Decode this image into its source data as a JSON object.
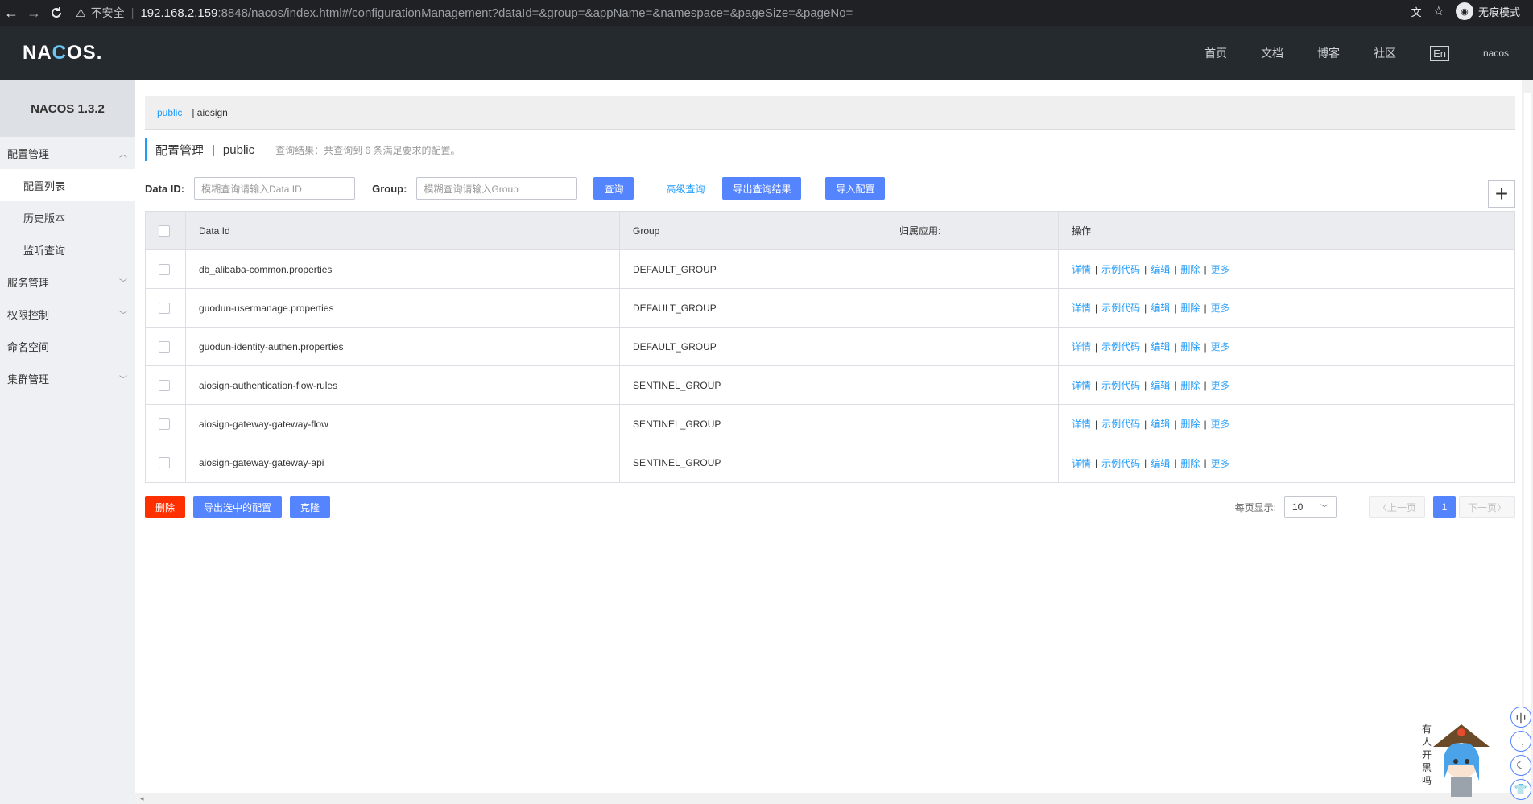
{
  "browser": {
    "back": "←",
    "forward": "→",
    "reload": "C",
    "warning_icon": "warning-triangle-icon",
    "insecure_label": "不安全",
    "url_host": "192.168.2.159",
    "url_path": ":8848/nacos/index.html#/configurationManagement?dataId=&group=&appName=&namespace=&pageSize=&pageNo=",
    "incognito_label": "无痕模式"
  },
  "header": {
    "logo": "NACOS.",
    "nav": [
      "首页",
      "文档",
      "博客",
      "社区"
    ],
    "lang": "En",
    "user": "nacos"
  },
  "sidebar": {
    "version": "NACOS 1.3.2",
    "groups": [
      {
        "label": "配置管理",
        "chevron": "up",
        "items": [
          "配置列表",
          "历史版本",
          "监听查询"
        ]
      },
      {
        "label": "服务管理",
        "chevron": "down"
      },
      {
        "label": "权限控制",
        "chevron": "down"
      },
      {
        "label": "命名空间"
      },
      {
        "label": "集群管理",
        "chevron": "down"
      }
    ],
    "active_item": "配置列表"
  },
  "namespaces": {
    "active": "public",
    "other": "| aiosign"
  },
  "page": {
    "title": "配置管理",
    "namespace": "public",
    "summary": "查询结果：共查询到 6 条满足要求的配置。"
  },
  "filters": {
    "data_id_label": "Data ID:",
    "data_id_placeholder": "模糊查询请输入Data ID",
    "group_label": "Group:",
    "group_placeholder": "模糊查询请输入Group",
    "query": "查询",
    "advanced": "高级查询",
    "export_results": "导出查询结果",
    "import": "导入配置",
    "add": "+"
  },
  "table": {
    "headers": [
      "Data Id",
      "Group",
      "归属应用:",
      "操作"
    ],
    "ops": [
      "详情",
      "示例代码",
      "编辑",
      "删除",
      "更多"
    ],
    "rows": [
      {
        "data_id": "db_alibaba-common.properties",
        "group": "DEFAULT_GROUP",
        "app": ""
      },
      {
        "data_id": "guodun-usermanage.properties",
        "group": "DEFAULT_GROUP",
        "app": ""
      },
      {
        "data_id": "guodun-identity-authen.properties",
        "group": "DEFAULT_GROUP",
        "app": ""
      },
      {
        "data_id": "aiosign-authentication-flow-rules",
        "group": "SENTINEL_GROUP",
        "app": ""
      },
      {
        "data_id": "aiosign-gateway-gateway-flow",
        "group": "SENTINEL_GROUP",
        "app": ""
      },
      {
        "data_id": "aiosign-gateway-gateway-api",
        "group": "SENTINEL_GROUP",
        "app": ""
      }
    ]
  },
  "bottom": {
    "delete": "删除",
    "export_selected": "导出选中的配置",
    "clone": "克隆",
    "page_size_label": "每页显示:",
    "page_size": "10",
    "prev": "上一页",
    "page": "1",
    "next": "下一页"
  },
  "widgets": {
    "mascot_text": "有人开黑吗",
    "tools": [
      "中",
      "˙,",
      "☾",
      "👕"
    ]
  },
  "colors": {
    "primary": "#5584ff",
    "link": "#209bfa",
    "danger": "#ff3000",
    "header_bg": "#252a2f"
  }
}
